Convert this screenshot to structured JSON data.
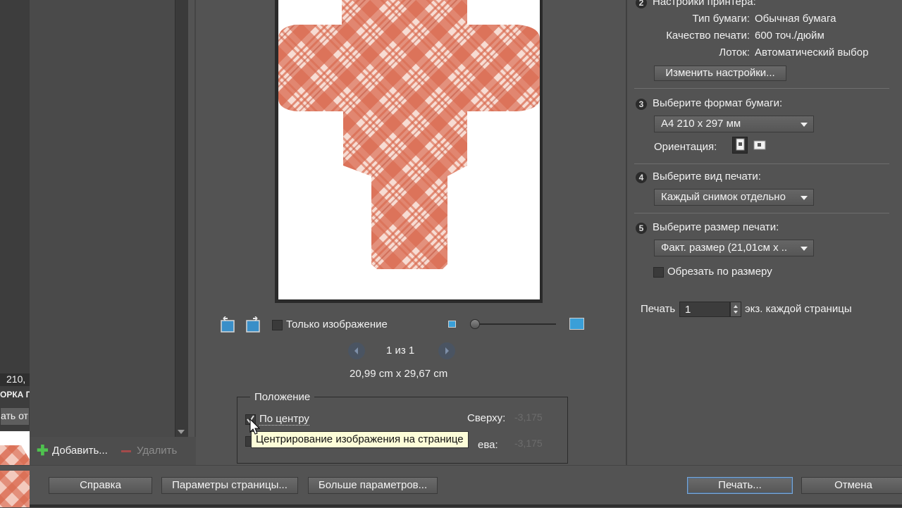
{
  "left": {
    "size_fragment": "210,",
    "label_fragment": "ОРКА П",
    "button_fragment": "ать от",
    "add_label": "Добавить...",
    "delete_label": "Удалить"
  },
  "preview": {
    "only_image_label": "Только изображение",
    "page_counter": "1 из 1",
    "dimensions": "20,99 cm x 29,67 cm",
    "zoom_level": 0.0
  },
  "position": {
    "group_label": "Положение",
    "center_label": "По центру",
    "center_checked": true,
    "top_label": "Сверху:",
    "top_value": "-3,175",
    "left_label": "Слева:",
    "left_visible_label": "ева:",
    "left_value": "-3,175",
    "tooltip": "Центрирование изображения на странице"
  },
  "printer": {
    "section_number": "2",
    "section_title": "Настройки принтера:",
    "paper_type_label": "Тип бумаги:",
    "paper_type_value": "Обычная бумага",
    "quality_label": "Качество печати:",
    "quality_value": "600 точ./дюйм",
    "tray_label": "Лоток:",
    "tray_value": "Автоматический выбор",
    "change_button": "Изменить настройки..."
  },
  "paper": {
    "section_number": "3",
    "section_title": "Выберите формат бумаги:",
    "selected": "A4 210 x 297 мм",
    "orientation_label": "Ориентация:"
  },
  "print_type": {
    "section_number": "4",
    "section_title": "Выберите вид печати:",
    "selected": "Каждый снимок отдельно"
  },
  "print_size": {
    "section_number": "5",
    "section_title": "Выберите размер печати:",
    "selected": "Факт. размер (21,01см x ..",
    "crop_label": "Обрезать по размеру",
    "crop_checked": false
  },
  "copies": {
    "label": "Печать",
    "value": "1",
    "suffix": "экз. каждой страницы"
  },
  "footer": {
    "help": "Справка",
    "page_setup": "Параметры страницы...",
    "more_options": "Больше параметров...",
    "print": "Печать...",
    "cancel": "Отмена"
  },
  "colors": {
    "background": "#535353",
    "pattern_red": "#d9694f",
    "accent_blue": "#3a9fd8"
  }
}
